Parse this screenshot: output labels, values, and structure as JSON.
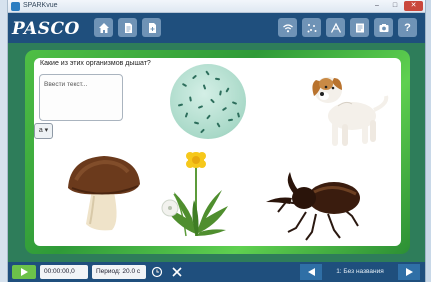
{
  "window": {
    "title": "SPARKvue",
    "minimize": "–",
    "maximize": "□",
    "close": "✕"
  },
  "toolbar": {
    "logo": "PASCO",
    "left_icons": [
      "home-icon",
      "document-icon",
      "new-page-icon"
    ],
    "right_icons": [
      "wireless-icon",
      "sensor-icon",
      "tools-icon",
      "journal-icon",
      "camera-icon",
      "help-icon"
    ],
    "help_label": "?"
  },
  "page": {
    "question": "Какие из этих организмов дышат?",
    "answer_placeholder": "Ввести текст...",
    "side_tool_label": "a ▾",
    "images": [
      "bacteria",
      "puppy",
      "mushroom",
      "dandelion",
      "beetle"
    ]
  },
  "bottombar": {
    "elapsed": "00:00:00,0",
    "period": "Период: 20.0 с",
    "page_label": "1: Без названия",
    "colors": {
      "bar": "#1f4f7d",
      "play": "#6cc24a",
      "nav": "#2f6fa6"
    }
  }
}
